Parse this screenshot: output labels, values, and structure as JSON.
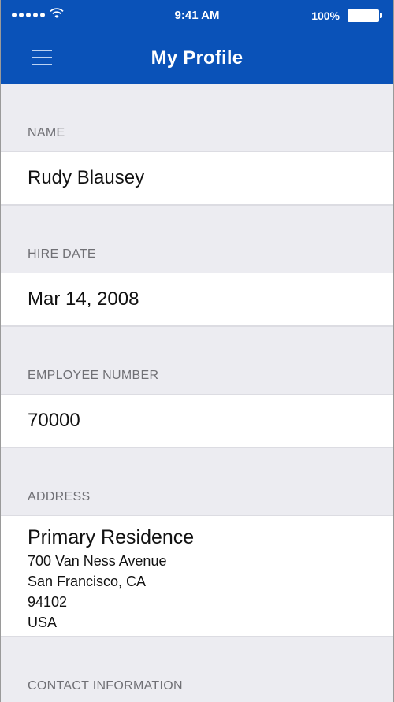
{
  "status_bar": {
    "time": "9:41 AM",
    "battery_percent": "100%"
  },
  "nav": {
    "title": "My Profile"
  },
  "profile": {
    "name_label": "NAME",
    "name_value": "Rudy Blausey",
    "hire_date_label": "HIRE DATE",
    "hire_date_value": "Mar 14, 2008",
    "employee_number_label": "EMPLOYEE NUMBER",
    "employee_number_value": "70000",
    "address_label": "ADDRESS",
    "address": {
      "type": "Primary Residence",
      "lines": [
        "700 Van Ness Avenue",
        "San Francisco, CA",
        "94102",
        "USA"
      ]
    },
    "contact_label": "CONTACT INFORMATION"
  },
  "icons": {
    "menu": "hamburger-menu-icon",
    "wifi": "wifi-icon",
    "battery": "battery-icon",
    "signal": "signal-icon"
  },
  "colors": {
    "header": "#0a52b8",
    "background": "#ececf1",
    "section_label": "#707075"
  }
}
